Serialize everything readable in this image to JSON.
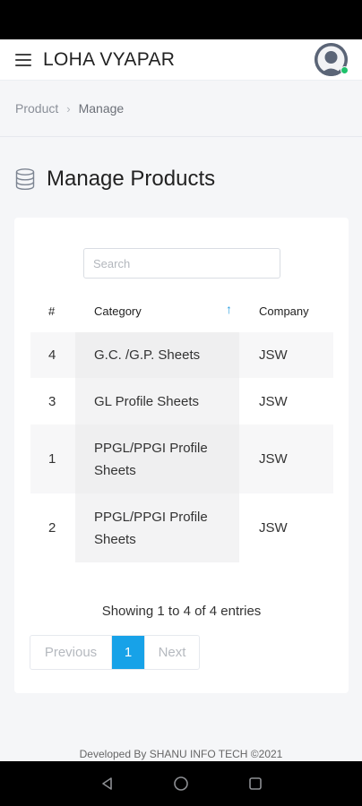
{
  "header": {
    "brand": "LOHA VYAPAR",
    "menu_icon": "hamburger-menu-icon",
    "avatar_icon": "user-avatar-icon",
    "status_color": "#1ec26b"
  },
  "breadcrumb": {
    "items": [
      "Product",
      "Manage"
    ],
    "separator": "›"
  },
  "page": {
    "title": "Manage Products",
    "icon": "database-icon"
  },
  "search": {
    "placeholder": "Search",
    "value": ""
  },
  "table": {
    "columns": [
      "#",
      "Category",
      "Company"
    ],
    "sort_column": "Category",
    "sort_direction": "ascending",
    "rows": [
      {
        "num": "4",
        "category": "G.C. /G.P. Sheets",
        "company": "JSW"
      },
      {
        "num": "3",
        "category": "GL Profile Sheets",
        "company": "JSW"
      },
      {
        "num": "1",
        "category": "PPGL/PPGI Profile Sheets",
        "company": "JSW"
      },
      {
        "num": "2",
        "category": "PPGL/PPGI Profile Sheets",
        "company": "JSW"
      }
    ]
  },
  "info": "Showing 1 to 4 of 4 entries",
  "pagination": {
    "previous": "Previous",
    "current": "1",
    "next": "Next"
  },
  "footer": "Developed By  SHANU INFO TECH ©2021",
  "colors": {
    "accent": "#17a2e8",
    "sort_arrow": "#2a9fe0"
  }
}
